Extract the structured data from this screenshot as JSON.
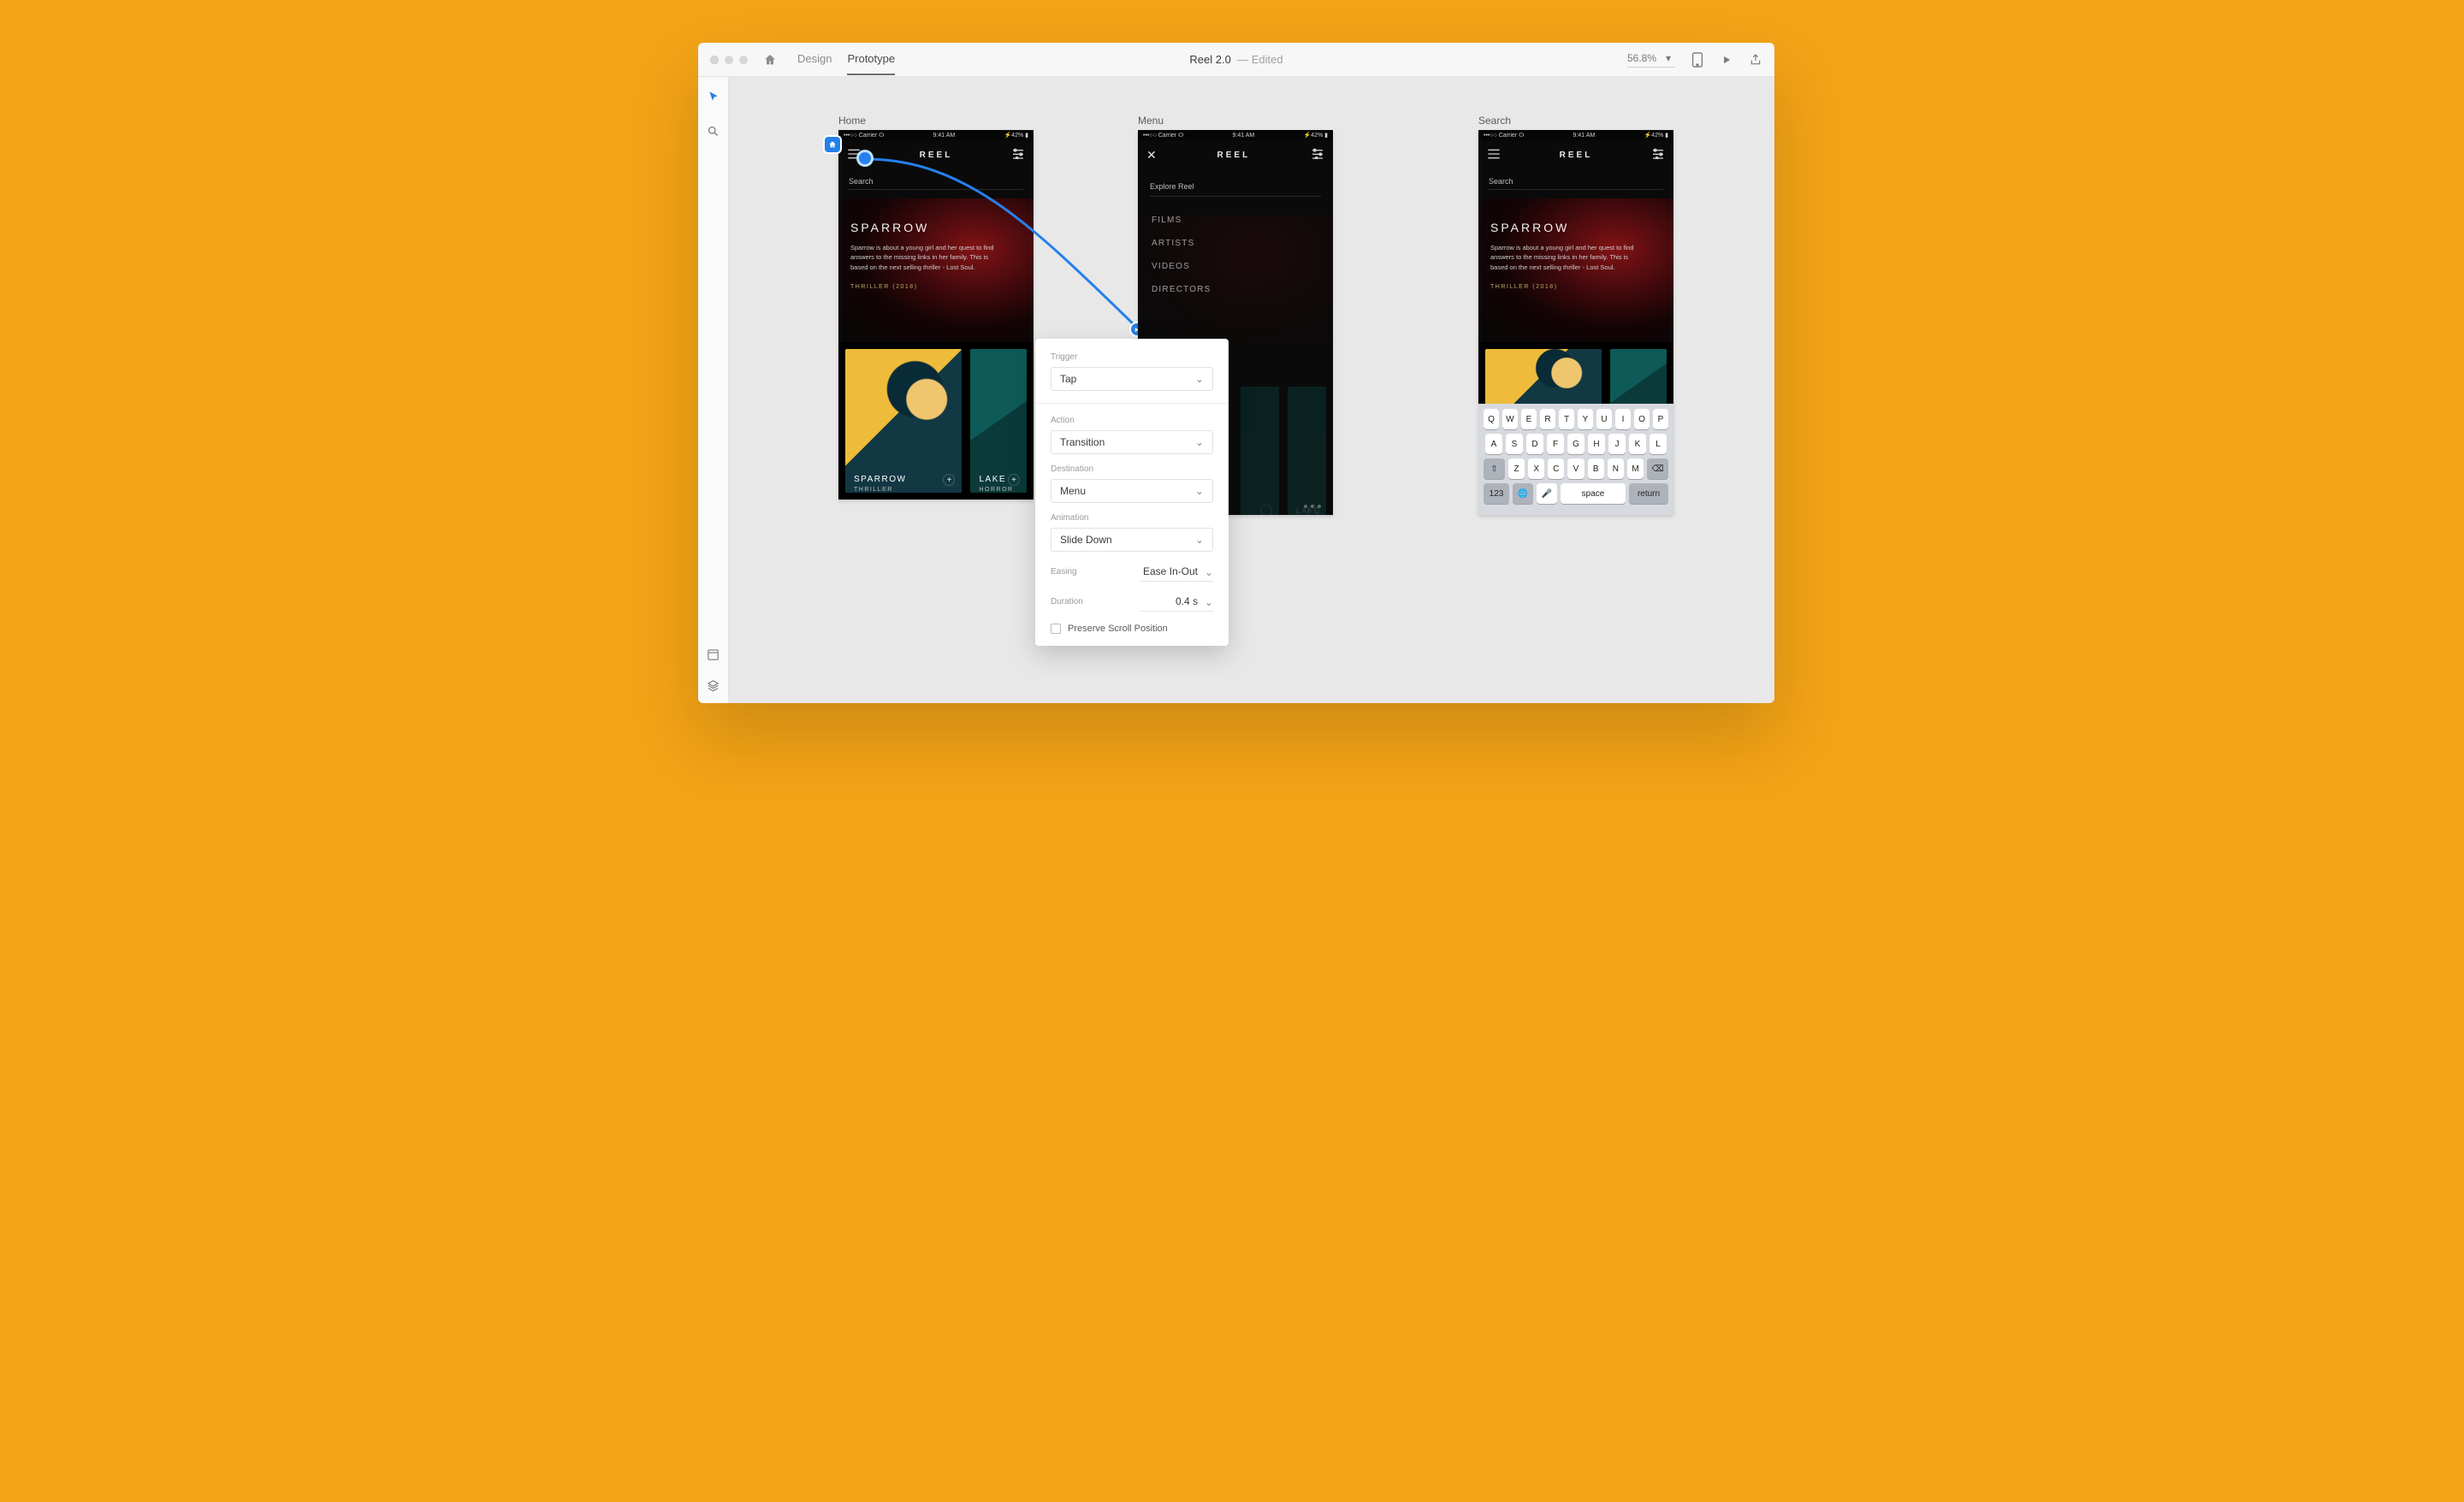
{
  "header": {
    "tabs": {
      "design": "Design",
      "prototype": "Prototype",
      "active": "prototype"
    },
    "doc_title": "Reel 2.0",
    "doc_status": "Edited",
    "zoom": "56.8%"
  },
  "artboards": {
    "home": {
      "label": "Home"
    },
    "menu": {
      "label": "Menu"
    },
    "search": {
      "label": "Search"
    }
  },
  "statusbar": {
    "carrier": "•••○○ Carrier ⵙ",
    "time": "9:41 AM",
    "battery": "⚡42% ▮"
  },
  "app": {
    "brand": "REEL",
    "search_placeholder": "Search",
    "menu_search_placeholder": "Explore Reel",
    "close_glyph": "✕",
    "menu_items": [
      "FILMS",
      "ARTISTS",
      "VIDEOS",
      "DIRECTORS"
    ],
    "hero": {
      "title": "SPARROW",
      "desc": "Sparrow is about a young girl and her quest to find answers to the missing links in her family. This is based on the next selling thriller - Lost Soul.",
      "tag": "THRILLER (2018)"
    },
    "cards": {
      "c1": {
        "title": "SPARROW",
        "sub": "THRILLER"
      },
      "c2": {
        "title": "LAKE",
        "sub": "HORROR"
      }
    }
  },
  "panel": {
    "trigger_label": "Trigger",
    "trigger_value": "Tap",
    "action_label": "Action",
    "action_value": "Transition",
    "destination_label": "Destination",
    "destination_value": "Menu",
    "animation_label": "Animation",
    "animation_value": "Slide Down",
    "easing_label": "Easing",
    "easing_value": "Ease In-Out",
    "duration_label": "Duration",
    "duration_value": "0.4 s",
    "preserve_label": "Preserve Scroll Position"
  },
  "keyboard": {
    "row1": [
      "Q",
      "W",
      "E",
      "R",
      "T",
      "Y",
      "U",
      "I",
      "O",
      "P"
    ],
    "row2": [
      "A",
      "S",
      "D",
      "F",
      "G",
      "H",
      "J",
      "K",
      "L"
    ],
    "row3": [
      "Z",
      "X",
      "C",
      "V",
      "B",
      "N",
      "M"
    ],
    "shift": "⇧",
    "backspace": "⌫",
    "numbers": "123",
    "globe": "🌐",
    "mic": "🎤",
    "space": "space",
    "return": "return"
  }
}
